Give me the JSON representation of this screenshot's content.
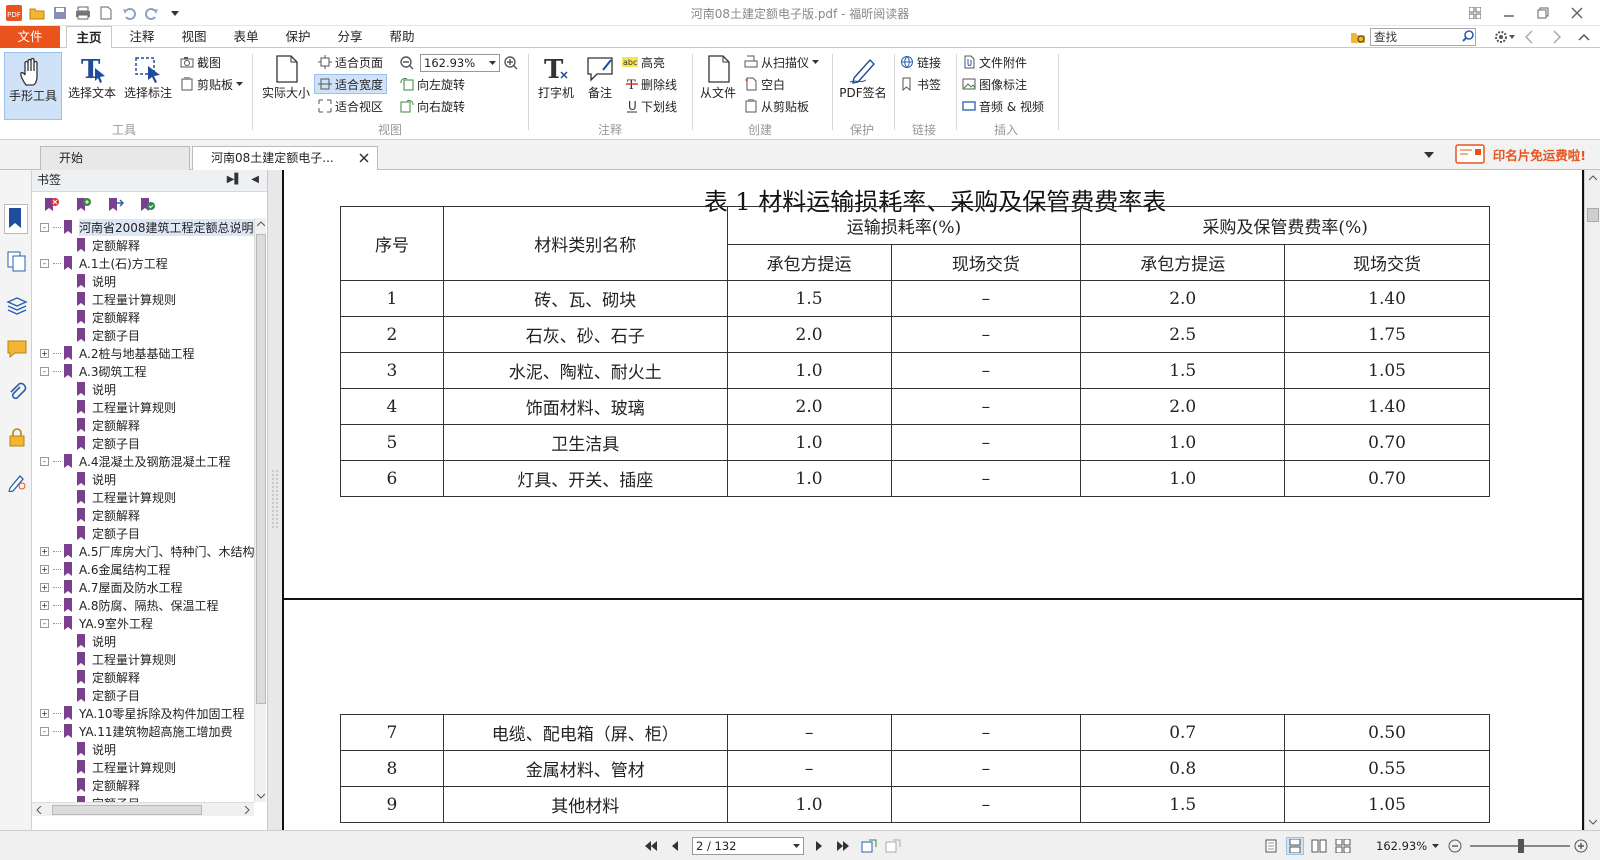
{
  "window": {
    "title": "河南08土建定额电子版.pdf - 福昕阅读器"
  },
  "menu": {
    "items": [
      "文件",
      "主页",
      "注释",
      "视图",
      "表单",
      "保护",
      "分享",
      "帮助"
    ]
  },
  "search": {
    "placeholder": "查找"
  },
  "ribbon": {
    "hand": "手形工具",
    "select_text": "选择文本",
    "select_annot": "选择标注",
    "snapshot": "截图",
    "clipboard": "剪贴板",
    "group_tools": "工具",
    "actual_size": "实际大小",
    "fit_page": "适合页面",
    "fit_width": "适合宽度",
    "fit_view": "适合视区",
    "zoom": "162.93%",
    "rotate_left": "向左旋转",
    "rotate_right": "向右旋转",
    "group_view": "视图",
    "typewriter": "打字机",
    "note": "备注",
    "highlight": "高亮",
    "strikeout": "删除线",
    "underline": "下划线",
    "group_comment": "注释",
    "from_file": "从文件",
    "from_scanner": "从扫描仪",
    "blank": "空白",
    "from_clipboard": "从剪贴板",
    "group_create": "创建",
    "pdf_sign": "PDF签名",
    "group_protect": "保护",
    "link": "链接",
    "bookmark": "书签",
    "group_link": "链接",
    "file_attach": "文件附件",
    "image_annot": "图像标注",
    "audio_video": "音频 & 视频",
    "group_insert": "插入"
  },
  "tabs": {
    "start": "开始",
    "doc": "河南08土建定额电子..."
  },
  "promo": {
    "text": "印名片免运费啦!"
  },
  "bookmarks": {
    "title": "书签",
    "items": [
      {
        "label": "河南省2008建筑工程定额总说明",
        "level": 0,
        "exp": "-"
      },
      {
        "label": "定额解释",
        "level": 1
      },
      {
        "label": "A.1土(石)方工程",
        "level": 0,
        "exp": "-"
      },
      {
        "label": "说明",
        "level": 1
      },
      {
        "label": "工程量计算规则",
        "level": 1
      },
      {
        "label": "定额解释",
        "level": 1
      },
      {
        "label": "定额子目",
        "level": 1
      },
      {
        "label": "A.2桩与地基基础工程",
        "level": 0,
        "exp": "+"
      },
      {
        "label": "A.3砌筑工程",
        "level": 0,
        "exp": "-"
      },
      {
        "label": "说明",
        "level": 1
      },
      {
        "label": "工程量计算规则",
        "level": 1
      },
      {
        "label": "定额解释",
        "level": 1
      },
      {
        "label": "定额子目",
        "level": 1
      },
      {
        "label": "A.4混凝土及钢筋混凝土工程",
        "level": 0,
        "exp": "-"
      },
      {
        "label": "说明",
        "level": 1
      },
      {
        "label": "工程量计算规则",
        "level": 1
      },
      {
        "label": "定额解释",
        "level": 1
      },
      {
        "label": "定额子目",
        "level": 1
      },
      {
        "label": "A.5厂库房大门、特种门、木结构",
        "level": 0,
        "exp": "+"
      },
      {
        "label": "A.6金属结构工程",
        "level": 0,
        "exp": "+"
      },
      {
        "label": "A.7屋面及防水工程",
        "level": 0,
        "exp": "+"
      },
      {
        "label": "A.8防腐、隔热、保温工程",
        "level": 0,
        "exp": "+"
      },
      {
        "label": "YA.9室外工程",
        "level": 0,
        "exp": "-"
      },
      {
        "label": "说明",
        "level": 1
      },
      {
        "label": "工程量计算规则",
        "level": 1
      },
      {
        "label": "定额解释",
        "level": 1
      },
      {
        "label": "定额子目",
        "level": 1
      },
      {
        "label": "YA.10零星拆除及构件加固工程",
        "level": 0,
        "exp": "+"
      },
      {
        "label": "YA.11建筑物超高施工增加费",
        "level": 0,
        "exp": "-"
      },
      {
        "label": "说明",
        "level": 1
      },
      {
        "label": "工程量计算规则",
        "level": 1
      },
      {
        "label": "定额解释",
        "level": 1
      },
      {
        "label": "定额子目",
        "level": 1
      }
    ]
  },
  "document": {
    "table_title": "表 1 材料运输损耗率、采购及保管费费率表",
    "headers": {
      "no": "序号",
      "name": "材料类别名称",
      "transport": "运输损耗率(%)",
      "purchase": "采购及保管费费率(%)",
      "contractor": "承包方提运",
      "site": "现场交货"
    },
    "rows_p1": [
      [
        "1",
        "砖、瓦、砌块",
        "1.5",
        "–",
        "2.0",
        "1.40"
      ],
      [
        "2",
        "石灰、砂、石子",
        "2.0",
        "–",
        "2.5",
        "1.75"
      ],
      [
        "3",
        "水泥、陶粒、耐火土",
        "1.0",
        "–",
        "1.5",
        "1.05"
      ],
      [
        "4",
        "饰面材料、玻璃",
        "2.0",
        "–",
        "2.0",
        "1.40"
      ],
      [
        "5",
        "卫生洁具",
        "1.0",
        "–",
        "1.0",
        "0.70"
      ],
      [
        "6",
        "灯具、开关、插座",
        "1.0",
        "–",
        "1.0",
        "0.70"
      ]
    ],
    "rows_p2": [
      [
        "7",
        "电缆、配电箱（屏、柜）",
        "–",
        "–",
        "0.7",
        "0.50"
      ],
      [
        "8",
        "金属材料、管材",
        "–",
        "–",
        "0.8",
        "0.55"
      ],
      [
        "9",
        "其他材料",
        "1.0",
        "–",
        "1.5",
        "1.05"
      ]
    ]
  },
  "status": {
    "page": "2 / 132",
    "zoom": "162.93%"
  },
  "colors": {
    "accent": "#e8541c",
    "bookmark_flag": "#7b3f8f"
  }
}
